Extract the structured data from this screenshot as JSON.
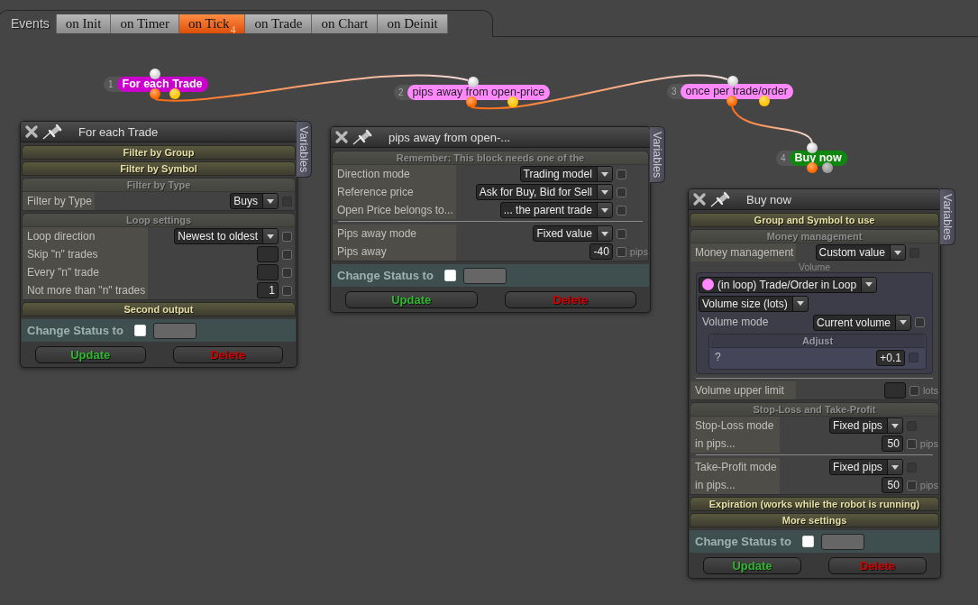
{
  "events_bar": {
    "label": "Events",
    "tabs": [
      {
        "label": "on Init",
        "selected": false
      },
      {
        "label": "on Timer",
        "selected": false
      },
      {
        "label": "on Tick",
        "selected": true,
        "badge": "4"
      },
      {
        "label": "on Trade",
        "selected": false
      },
      {
        "label": "on Chart",
        "selected": false
      },
      {
        "label": "on Deinit",
        "selected": false
      }
    ]
  },
  "nodes": [
    {
      "number": "1",
      "label": "For each Trade",
      "kind": "loop",
      "color": "#cc00cc"
    },
    {
      "number": "2",
      "label": "pips away from open-price",
      "kind": "condition",
      "color": "#ff88ff"
    },
    {
      "number": "3",
      "label": "once per trade/order",
      "kind": "condition",
      "color": "#ff88ff"
    },
    {
      "number": "4",
      "label": "Buy now",
      "kind": "action",
      "color": "#0f870f"
    }
  ],
  "panels": [
    {
      "title": "For each Trade",
      "side_tab": "Variables",
      "sections": [
        {
          "kind": "header",
          "label": "Filter by Group"
        },
        {
          "kind": "header",
          "label": "Filter by Symbol"
        },
        {
          "kind": "group",
          "title": "Filter by Type",
          "rows": [
            {
              "kind": "select",
              "label": "Filter by Type",
              "value": "Buys",
              "checkbox": {
                "checked": false,
                "disabled": true
              }
            }
          ]
        },
        {
          "kind": "group",
          "title": "Loop settings",
          "rows": [
            {
              "kind": "select",
              "label": "Loop direction",
              "value": "Newest to oldest",
              "checkbox": {
                "checked": false,
                "disabled": false
              }
            },
            {
              "kind": "input",
              "label": "Skip \"n\" trades",
              "checkbox": {
                "checked": false,
                "disabled": false
              }
            },
            {
              "kind": "input",
              "label": "Every \"n\" trade",
              "checkbox": {
                "checked": false,
                "disabled": false
              }
            },
            {
              "kind": "input",
              "label": "Not more than \"n\" trades",
              "value": "1",
              "checkbox": {
                "checked": false,
                "disabled": false
              }
            }
          ]
        },
        {
          "kind": "header",
          "label": "Second output"
        },
        {
          "kind": "status",
          "label": "Change Status to",
          "checked": false
        }
      ],
      "buttons": [
        {
          "label": "Update",
          "kind": "update"
        },
        {
          "label": "Delete",
          "kind": "delete"
        }
      ]
    },
    {
      "title": "pips away from open-...",
      "side_tab": "Variables",
      "sections": [
        {
          "kind": "group",
          "title": "Remember: This block needs one of the",
          "rows": [
            {
              "kind": "select",
              "label": "Direction mode",
              "value": "Trading model",
              "checkbox": {
                "checked": false,
                "disabled": false
              }
            },
            {
              "kind": "select",
              "label": "Reference price",
              "value": "Ask for Buy, Bid for Sell",
              "checkbox": {
                "checked": false,
                "disabled": false
              }
            },
            {
              "kind": "select",
              "label": "Open Price belongs to...",
              "value": "... the parent trade",
              "checkbox": {
                "checked": false,
                "disabled": false
              }
            },
            {
              "kind": "divider"
            },
            {
              "kind": "select",
              "label": "Pips away mode",
              "value": "Fixed value",
              "checkbox": {
                "checked": false,
                "disabled": false
              }
            },
            {
              "kind": "input",
              "label": "Pips away",
              "value": "-40",
              "unit": "pips",
              "checkbox": {
                "checked": false,
                "disabled": false
              }
            }
          ]
        },
        {
          "kind": "status",
          "label": "Change Status to",
          "checked": false
        }
      ],
      "buttons": [
        {
          "label": "Update",
          "kind": "update"
        },
        {
          "label": "Delete",
          "kind": "delete"
        }
      ]
    },
    {
      "title": "Buy now",
      "side_tab": "Variables",
      "sections": [
        {
          "kind": "header",
          "label": "Group and Symbol to use"
        },
        {
          "kind": "group",
          "title": "Money management",
          "rows": [
            {
              "kind": "select",
              "label": "Money management",
              "value": "Custom value",
              "checkbox": {
                "checked": false,
                "disabled": true
              }
            },
            {
              "kind": "caption",
              "text": "Volume"
            },
            {
              "kind": "box",
              "rows": [
                {
                  "kind": "select",
                  "value": "(in loop) Trade/Order in Loop",
                  "color": "#ff88ff"
                },
                {
                  "kind": "select",
                  "value": "Volume size (lots)"
                },
                {
                  "kind": "select",
                  "label": "Volume mode",
                  "value": "Current volume",
                  "checkbox": {
                    "checked": false,
                    "disabled": false
                  }
                },
                {
                  "kind": "box",
                  "title": "Adjust",
                  "rows": [
                    {
                      "kind": "input",
                      "label": "?",
                      "value": "+0.1",
                      "checkbox": {
                        "checked": false,
                        "disabled": true
                      }
                    }
                  ]
                }
              ]
            },
            {
              "kind": "divider"
            },
            {
              "kind": "input",
              "label": "Volume upper limit",
              "unit": "lots",
              "checkbox": {
                "checked": false,
                "disabled": false
              }
            }
          ]
        },
        {
          "kind": "group",
          "title": "Stop-Loss and Take-Profit",
          "rows": [
            {
              "kind": "select",
              "label": "Stop-Loss mode",
              "value": "Fixed pips",
              "checkbox": {
                "checked": false,
                "disabled": true
              }
            },
            {
              "kind": "input",
              "label": "in pips...",
              "value": "50",
              "unit": "pips",
              "checkbox": {
                "checked": false,
                "disabled": false
              }
            },
            {
              "kind": "divider"
            },
            {
              "kind": "select",
              "label": "Take-Profit mode",
              "value": "Fixed pips",
              "checkbox": {
                "checked": false,
                "disabled": true
              }
            },
            {
              "kind": "input",
              "label": "in pips...",
              "value": "50",
              "unit": "pips",
              "checkbox": {
                "checked": false,
                "disabled": false
              }
            }
          ]
        },
        {
          "kind": "header",
          "label": "Expiration (works while the robot is running)"
        },
        {
          "kind": "header",
          "label": "More settings"
        },
        {
          "kind": "status",
          "label": "Change Status to",
          "checked": false
        }
      ],
      "buttons": [
        {
          "label": "Update",
          "kind": "update"
        },
        {
          "label": "Delete",
          "kind": "delete"
        }
      ]
    }
  ]
}
